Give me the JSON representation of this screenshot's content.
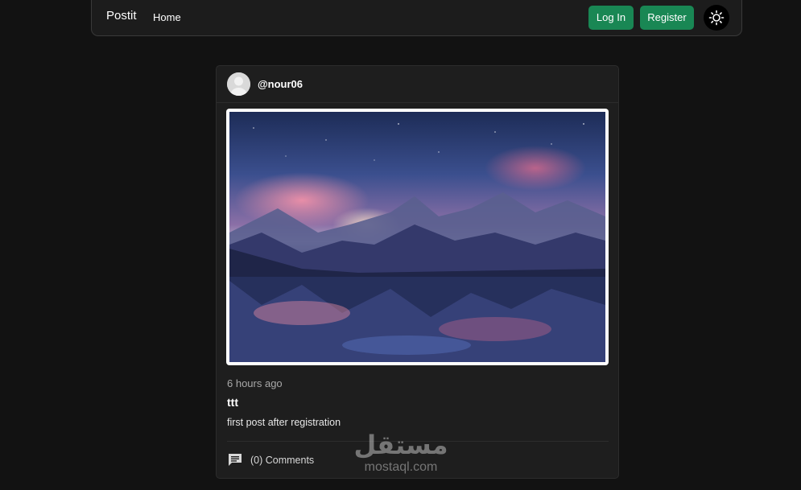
{
  "nav": {
    "brand": "Postit",
    "home_label": "Home",
    "login_label": "Log In",
    "register_label": "Register",
    "theme_icon": "sun-icon",
    "button_color": "#198754"
  },
  "post": {
    "username": "@nour06",
    "time_ago": "6 hours ago",
    "title": "ttt",
    "body": "first post after registration",
    "comments_label": "(0) Comments",
    "image_alt": "mountain-lake-landscape-image"
  },
  "watermark": {
    "arabic": "مستقل",
    "latin": "mostaql.com"
  },
  "colors": {
    "background": "#121212",
    "card": "#1e1e1e",
    "accent": "#198754"
  }
}
